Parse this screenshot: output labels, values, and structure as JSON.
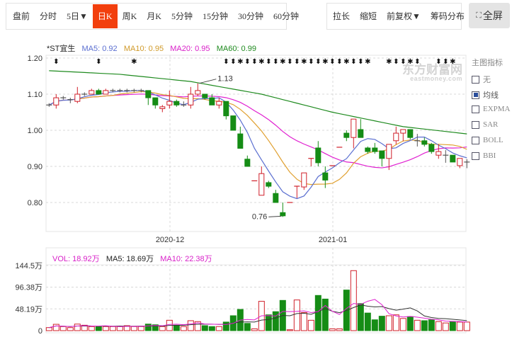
{
  "toolbar_left": [
    {
      "label": "盘前"
    },
    {
      "label": "分时"
    },
    {
      "label": "5日▼"
    },
    {
      "label": "日K",
      "active": true
    },
    {
      "label": "周K"
    },
    {
      "label": "月K"
    },
    {
      "label": "5分钟"
    },
    {
      "label": "15分钟"
    },
    {
      "label": "30分钟"
    },
    {
      "label": "60分钟"
    }
  ],
  "toolbar_right": [
    {
      "label": "拉长"
    },
    {
      "label": "缩短"
    },
    {
      "label": "前复权▼"
    },
    {
      "label": "筹码分布"
    }
  ],
  "fullscreen": {
    "label": "全屏",
    "icon": "expand-icon"
  },
  "legend": {
    "name": "*ST宜生",
    "ma5": "MA5: 0.92",
    "ma10": "MA10: 0.95",
    "ma20": "MA20: 0.95",
    "ma60": "MA60: 0.99"
  },
  "vol_legend": {
    "vol": "VOL: 18.92万",
    "ma5": "MA5: 18.69万",
    "ma10": "MA10: 22.38万"
  },
  "indicators": {
    "title": "主图指标",
    "items": [
      {
        "label": "无",
        "checked": false
      },
      {
        "label": "均线",
        "checked": true
      },
      {
        "label": "EXPMA",
        "checked": false
      },
      {
        "label": "SAR",
        "checked": false
      },
      {
        "label": "BOLL",
        "checked": false
      },
      {
        "label": "BBI",
        "checked": false
      }
    ]
  },
  "watermark": {
    "cn": "东方财富网",
    "en": "eastmoney.com"
  },
  "colors": {
    "up": "#d0202a",
    "down": "#158c15",
    "doji": "#555555",
    "ma5": "#5b6fd0",
    "ma10": "#e0a030",
    "ma20": "#e020d0",
    "ma60": "#1e8a1e",
    "accent": "#f23f0d"
  },
  "chart_data": [
    {
      "type": "candlestick",
      "title": "*ST宜生",
      "ylim": [
        0.75,
        1.2
      ],
      "y_ticks": [
        "1.20",
        "1.10",
        "1.00",
        "0.90",
        "0.80"
      ],
      "y_tick_values": [
        1.2,
        1.1,
        1.0,
        0.9,
        0.8
      ],
      "x_labels": [
        {
          "label": "2020-12",
          "index": 17
        },
        {
          "label": "2021-01",
          "index": 40
        }
      ],
      "annotations": [
        {
          "label": "1.13",
          "index": 21,
          "value": 1.13
        },
        {
          "label": "0.76",
          "index": 33,
          "value": 0.76
        }
      ],
      "event_markers": [
        1,
        7,
        12,
        25,
        26,
        27,
        28,
        29,
        30,
        31,
        32,
        33,
        34,
        35,
        36,
        37,
        38,
        39,
        40,
        41,
        42,
        43,
        44,
        45,
        48,
        49,
        50,
        51,
        52,
        55,
        56,
        57
      ],
      "ohlc": [
        [
          1.07,
          1.075,
          1.065,
          1.07
        ],
        [
          1.07,
          1.1,
          1.06,
          1.09
        ],
        [
          1.09,
          1.095,
          1.085,
          1.09
        ],
        [
          1.085,
          1.09,
          1.075,
          1.085
        ],
        [
          1.08,
          1.12,
          1.075,
          1.1
        ],
        [
          1.1,
          1.105,
          1.095,
          1.1
        ],
        [
          1.1,
          1.115,
          1.1,
          1.11
        ],
        [
          1.11,
          1.115,
          1.1,
          1.1
        ],
        [
          1.1,
          1.115,
          1.1,
          1.11
        ],
        [
          1.11,
          1.115,
          1.105,
          1.11
        ],
        [
          1.11,
          1.115,
          1.105,
          1.11
        ],
        [
          1.11,
          1.115,
          1.105,
          1.11
        ],
        [
          1.11,
          1.115,
          1.105,
          1.11
        ],
        [
          1.11,
          1.115,
          1.105,
          1.11
        ],
        [
          1.11,
          1.11,
          1.07,
          1.09
        ],
        [
          1.09,
          1.09,
          1.06,
          1.07
        ],
        [
          1.06,
          1.07,
          1.05,
          1.065
        ],
        [
          1.07,
          1.11,
          1.06,
          1.08
        ],
        [
          1.08,
          1.085,
          1.065,
          1.07
        ],
        [
          1.07,
          1.08,
          1.065,
          1.07
        ],
        [
          1.07,
          1.12,
          1.06,
          1.1
        ],
        [
          1.1,
          1.13,
          1.095,
          1.11
        ],
        [
          1.1,
          1.1,
          1.085,
          1.09
        ],
        [
          1.09,
          1.1,
          1.07,
          1.07
        ],
        [
          1.07,
          1.09,
          1.06,
          1.08
        ],
        [
          1.08,
          1.08,
          1.03,
          1.04
        ],
        [
          1.04,
          1.04,
          1.0,
          1.0
        ],
        [
          0.99,
          1.01,
          0.95,
          0.95
        ],
        [
          0.92,
          0.93,
          0.9,
          0.9
        ],
        [
          0.86,
          0.86,
          0.86,
          0.86
        ],
        [
          0.82,
          0.9,
          0.82,
          0.88
        ],
        [
          0.855,
          0.86,
          0.84,
          0.845
        ],
        [
          0.825,
          0.835,
          0.8,
          0.8
        ],
        [
          0.772,
          0.8,
          0.76,
          0.763
        ],
        [
          0.8,
          0.8,
          0.8,
          0.8
        ],
        [
          0.845,
          0.845,
          0.812,
          0.8451
        ],
        [
          0.843,
          0.882,
          0.835,
          0.882
        ],
        [
          0.922,
          0.922,
          0.9,
          0.9221
        ],
        [
          0.951,
          0.97,
          0.9,
          0.91
        ],
        [
          0.882,
          0.9,
          0.84,
          0.862
        ],
        [
          0.902,
          0.902,
          0.902,
          0.902
        ],
        [
          0.953,
          0.953,
          0.953,
          0.953
        ],
        [
          0.992,
          1.0,
          0.97,
          0.98
        ],
        [
          0.98,
          1.031,
          0.95,
          1.031
        ],
        [
          1.002,
          1.031,
          0.98,
          0.98
        ],
        [
          0.951,
          0.955,
          0.935,
          0.941
        ],
        [
          0.951,
          0.965,
          0.935,
          0.941
        ],
        [
          0.943,
          0.943,
          0.9,
          0.922
        ],
        [
          0.922,
          0.961,
          0.89,
          0.961
        ],
        [
          0.971,
          1.01,
          0.961,
          0.992
        ],
        [
          0.992,
          1.002,
          0.97,
          1.002
        ],
        [
          1.002,
          1.002,
          0.975,
          0.98
        ],
        [
          0.971,
          0.99,
          0.955,
          0.971
        ],
        [
          0.971,
          0.98,
          0.955,
          0.961
        ],
        [
          0.961,
          0.965,
          0.935,
          0.941
        ],
        [
          0.931,
          0.961,
          0.921,
          0.941
        ],
        [
          0.931,
          0.945,
          0.91,
          0.931
        ],
        [
          0.931,
          0.931,
          0.912,
          0.912
        ],
        [
          0.902,
          0.922,
          0.895,
          0.922
        ],
        [
          0.912,
          0.92,
          0.895,
          0.912
        ]
      ],
      "ma60_knots": {
        "index": [
          0,
          10,
          20,
          30,
          40,
          50,
          59
        ],
        "value": [
          1.165,
          1.155,
          1.135,
          1.1,
          1.05,
          1.01,
          0.99
        ]
      }
    },
    {
      "type": "bar",
      "title": "VOL",
      "unit": "万",
      "ylim": [
        0,
        150
      ],
      "y_ticks": [
        "144.5万",
        "96.38万",
        "48.19万",
        "0"
      ],
      "y_tick_values": [
        144.5,
        96.38,
        48.19,
        0
      ],
      "values": [
        6.7,
        14,
        9,
        6.7,
        14.5,
        12,
        9,
        9,
        9,
        9,
        9,
        11,
        9,
        9,
        14.5,
        13,
        9,
        23,
        12,
        9,
        22,
        20,
        11,
        9,
        9,
        19,
        33,
        47,
        16,
        4,
        65,
        35,
        42,
        67,
        2,
        68,
        40,
        23,
        78,
        70,
        4,
        4,
        90,
        133,
        60,
        39,
        24,
        32,
        33,
        35,
        27,
        31,
        23,
        22,
        24,
        20,
        17,
        20,
        19,
        19
      ]
    }
  ]
}
